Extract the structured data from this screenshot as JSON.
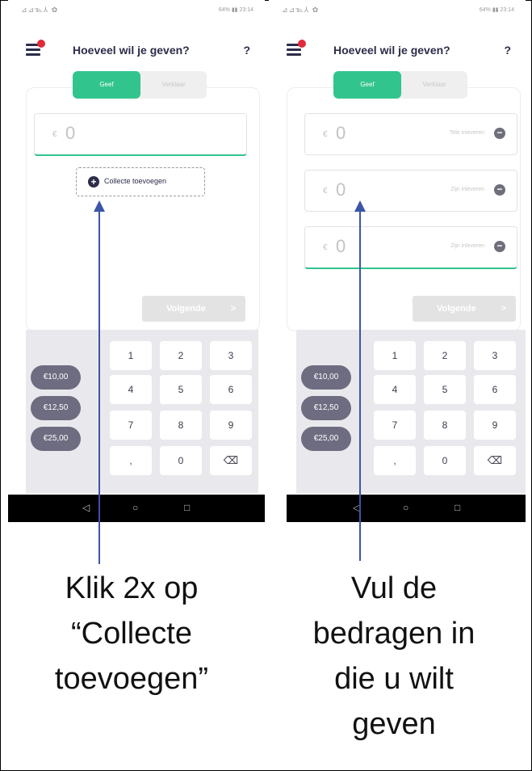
{
  "left_phone": {
    "status_left": "⊿⊿℡⅄ ✿",
    "status_right": "64% ▮▮ 23:14",
    "title": "Hoeveel wil je geven?",
    "help": "?",
    "tab_active": "Geef",
    "tab_inactive": "Verklaar",
    "amount_currency": "€",
    "amount_value": "0",
    "add_button_label": "Collecte toevoegen",
    "next_label": "Volgende",
    "next_chevron": ">"
  },
  "right_phone": {
    "status_left": "⊿⊿℡⅄ ✿",
    "status_right": "64% ▮▮ 23:14",
    "title": "Hoeveel wil je geven?",
    "help": "?",
    "tab_active": "Geef",
    "tab_inactive": "Verklaar",
    "amounts": [
      {
        "currency": "€",
        "value": "0",
        "remove_label": "Tele inleveren"
      },
      {
        "currency": "€",
        "value": "0",
        "remove_label": "Zijn inleveren"
      },
      {
        "currency": "€",
        "value": "0",
        "remove_label": "Zijn inleveren"
      }
    ],
    "next_label": "Volgende",
    "next_chevron": ">"
  },
  "keypad": {
    "keys": [
      "1",
      "2",
      "3",
      "4",
      "5",
      "6",
      "7",
      "8",
      "9",
      ",",
      "0",
      "⌫"
    ],
    "presets": [
      "€10,00",
      "€12,50",
      "€25,00"
    ]
  },
  "navbar": {
    "back": "◁",
    "home": "○",
    "recent": "□"
  },
  "captions": {
    "left": "Klik 2x op\n“Collecte\ntoevoegen”",
    "right": "Vul de\nbedragen in\ndie u wilt\ngeven"
  },
  "colors": {
    "accent": "#32c48d",
    "navy": "#2c2c4a",
    "preset": "#6e6c80",
    "arrow": "#3b55a8"
  }
}
